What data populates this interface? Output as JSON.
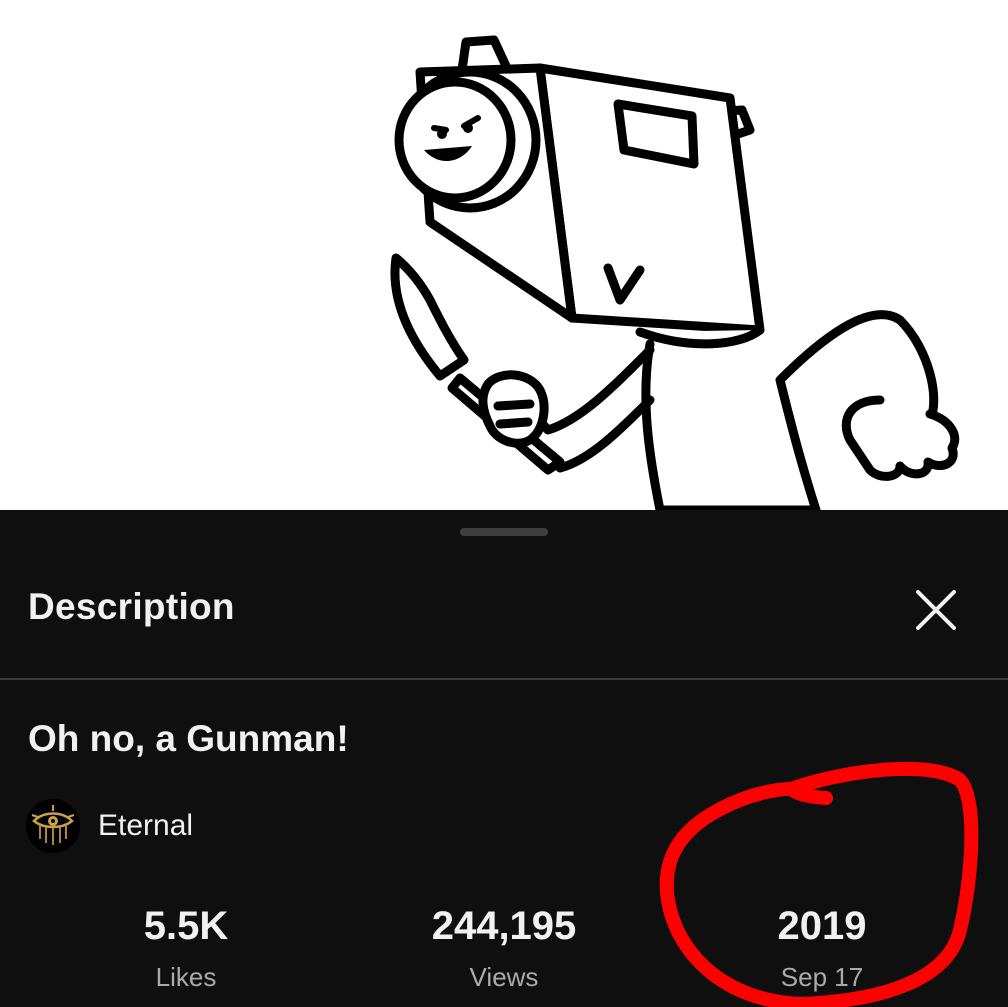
{
  "video": {
    "thumbnail_icon": "camera-head-man-with-knife-illustration"
  },
  "sheet": {
    "title": "Description",
    "close_icon": "close-icon"
  },
  "details": {
    "video_title": "Oh no, a Gunman!",
    "channel": {
      "name": "Eternal",
      "avatar_icon": "golden-eye-logo"
    },
    "stats": [
      {
        "value": "5.5K",
        "label": "Likes"
      },
      {
        "value": "244,195",
        "label": "Views"
      },
      {
        "value": "2019",
        "label": "Sep 17"
      }
    ]
  },
  "colors": {
    "sheet_background": "#0f0f0f",
    "primary_text": "#f1f1f1",
    "secondary_text": "#aaaaaa",
    "annotation_red": "#ff0000"
  }
}
